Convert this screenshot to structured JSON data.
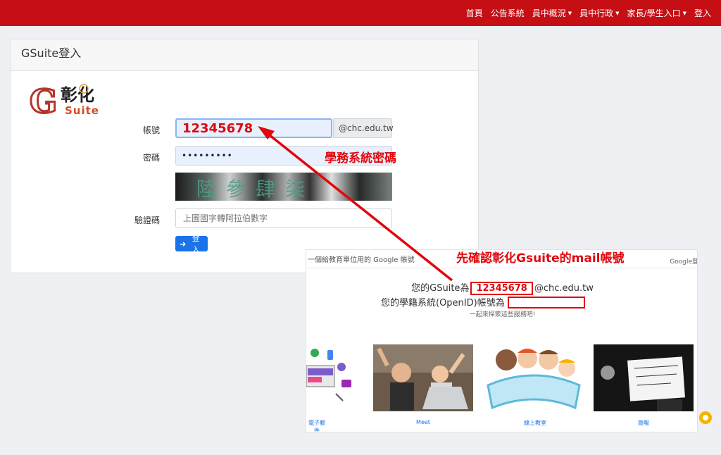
{
  "nav": {
    "items": [
      {
        "label": "首頁",
        "has_caret": false
      },
      {
        "label": "公告系統",
        "has_caret": false
      },
      {
        "label": "員中概況",
        "has_caret": true
      },
      {
        "label": "員中行政",
        "has_caret": true
      },
      {
        "label": "家長/學生入口",
        "has_caret": true
      },
      {
        "label": "登入",
        "has_caret": false
      }
    ]
  },
  "card": {
    "title": "GSuite登入",
    "logo_text": {
      "letter": "G",
      "word1": "彰化",
      "word2": "Suite"
    },
    "account_label": "帳號",
    "account_value": "12345678",
    "account_suffix": "@chc.edu.tw",
    "password_label": "密碼",
    "password_value": "•••••••••",
    "captcha_text": "陸參肆柒",
    "captcha_label": "驗證碼",
    "captcha_placeholder": "上圖國字轉阿拉伯數字",
    "login_button": "登入"
  },
  "overlay": {
    "top_left": "一個給教育單位用的 Google 帳號",
    "top_right": "Google登",
    "line1_prefix": "您的GSuite為",
    "line1_value": "12345678",
    "line1_suffix": "@chc.edu.tw",
    "line2": "您的學籍系統(OpenID)帳號為",
    "line3": "一起來探索這些服務吧!",
    "tiles": [
      "電子郵件",
      "Meet",
      "線上教室",
      "簡報"
    ]
  },
  "annotations": {
    "password_note": "學務系統密碼",
    "mail_note": "先確認彰化Gsuite的mail帳號"
  },
  "colors": {
    "navbar": "#c50f15",
    "annotation": "#e0070d",
    "button": "#1a73e8"
  }
}
